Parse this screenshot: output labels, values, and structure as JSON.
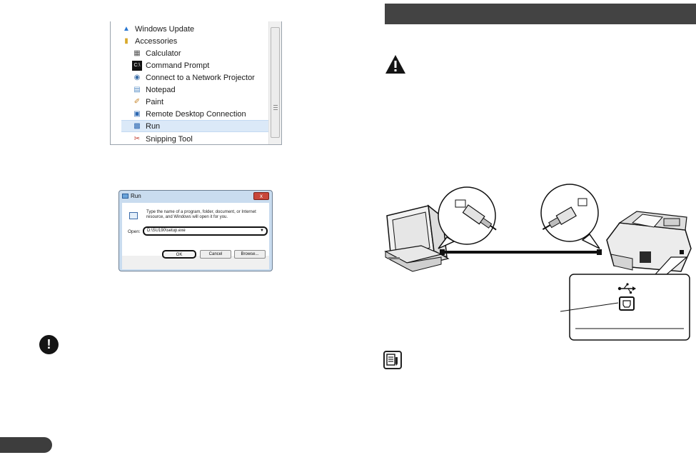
{
  "start_menu": {
    "items": [
      {
        "label": "Windows Update",
        "icon": "windows-update-icon"
      },
      {
        "label": "Accessories",
        "icon": "folder-icon"
      },
      {
        "label": "Calculator",
        "icon": "calculator-icon"
      },
      {
        "label": "Command Prompt",
        "icon": "command-prompt-icon"
      },
      {
        "label": "Connect to a Network Projector",
        "icon": "projector-icon"
      },
      {
        "label": "Notepad",
        "icon": "notepad-icon"
      },
      {
        "label": "Paint",
        "icon": "paint-icon"
      },
      {
        "label": "Remote Desktop Connection",
        "icon": "remote-desktop-icon"
      },
      {
        "label": "Run",
        "icon": "run-icon"
      },
      {
        "label": "Snipping Tool",
        "icon": "snipping-tool-icon"
      }
    ]
  },
  "run_dialog": {
    "title": "Run",
    "close_glyph": "x",
    "description": "Type the name of a program, folder, document, or Internet resource, and Windows will open it for you.",
    "open_label": "Open:",
    "open_value": "D:\\SU190\\setup.exe",
    "ok_label": "OK",
    "cancel_label": "Cancel",
    "browse_label": "Browse..."
  },
  "notices": {
    "important_glyph": "!",
    "caution_glyph": "!"
  }
}
